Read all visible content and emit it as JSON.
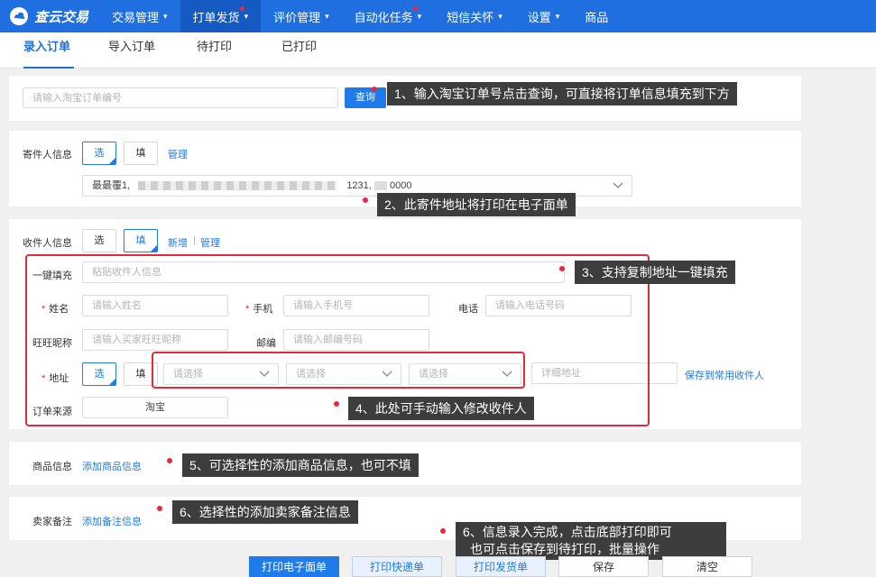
{
  "nav": {
    "brand": "查云交易",
    "items": [
      {
        "label": "交易管理",
        "chev": true,
        "dot": false,
        "active": false
      },
      {
        "label": "打单发货",
        "chev": true,
        "dot": true,
        "active": true
      },
      {
        "label": "评价管理",
        "chev": true,
        "dot": false,
        "active": false
      },
      {
        "label": "自动化任务",
        "chev": true,
        "dot": true,
        "active": false
      },
      {
        "label": "短信关怀",
        "chev": true,
        "dot": false,
        "active": false
      },
      {
        "label": "设置",
        "chev": true,
        "dot": false,
        "active": false
      },
      {
        "label": "商品",
        "chev": false,
        "dot": false,
        "active": false
      }
    ]
  },
  "subtabs": [
    "录入订单",
    "导入订单",
    "待打印",
    "已打印"
  ],
  "query": {
    "placeholder": "请输入淘宝订单编号",
    "button": "查询"
  },
  "sender": {
    "label": "寄件人信息",
    "choose": "选",
    "fill": "填",
    "manage": "管理",
    "address": "最最覆1,"
  },
  "receiver": {
    "label": "收件人信息",
    "choose": "选",
    "fill": "填",
    "add": "新增",
    "manage": "管理",
    "quickfill_label": "一键填充",
    "quickfill_placeholder": "粘贴收件人信息",
    "name_label": "姓名",
    "name_placeholder": "请输入姓名",
    "mobile_label": "手机",
    "mobile_placeholder": "请输入手机号",
    "phone_label": "电话",
    "phone_placeholder": "请输入电话号码",
    "wangwang_label": "旺旺昵称",
    "wangwang_placeholder": "请输入买家旺旺昵称",
    "zip_label": "邮编",
    "zip_placeholder": "请输入邮编号码",
    "address_label": "地址",
    "address_choose": "选",
    "address_fill": "填",
    "select_placeholder": "请选择",
    "detail_placeholder": "详细地址",
    "save_contact": "保存到常用收件人",
    "source_label": "订单来源",
    "source_value": "淘宝"
  },
  "goods": {
    "label": "商品信息",
    "link": "添加商品信息"
  },
  "remark": {
    "label": "卖家备注",
    "link": "添加备注信息"
  },
  "tips": {
    "t1": "1、输入淘宝订单号点击查询，可直接将订单信息填充到下方",
    "t2": "2、此寄件地址将打印在电子面单",
    "t3": "3、支持复制地址一键填充",
    "t4": "4、此处可手动输入修改收件人",
    "t5": "5、可选择性的添加商品信息，也可不填",
    "t6a": "6、选择性的添加卖家备注信息",
    "t6b_line1": "6、信息录入完成，点击底部打印即可",
    "t6b_line2": "也可点击保存到待打印，批量操作"
  },
  "footer": {
    "print_waybill": "打印电子面单",
    "print_express": "打印快递单",
    "print_delivery": "打印发货单",
    "save": "保存",
    "clear": "清空"
  },
  "colors": {
    "primary": "#1f6fe0",
    "button": "#1f7be9",
    "tooltip": "#3d3d3d",
    "highlight": "#e8293a"
  }
}
